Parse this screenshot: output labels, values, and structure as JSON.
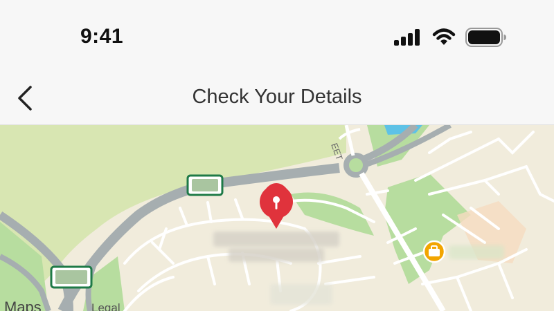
{
  "status_bar": {
    "time": "9:41",
    "signal_icon": "cellular-signal-icon",
    "wifi_icon": "wifi-icon",
    "battery_icon": "battery-icon"
  },
  "nav": {
    "back_icon": "chevron-left-icon",
    "title": "Check Your Details"
  },
  "map": {
    "street_label": "EET",
    "pin_icon": "location-pin-icon",
    "poi_icon": "briefcase-icon",
    "attribution": "Maps",
    "legal": "Legal",
    "colors": {
      "land": "#f1ecdc",
      "park": "#d8e6b2",
      "green": "#b7dd9f",
      "road": "#a6aeb0",
      "water": "#5ec2e6",
      "pin": "#e0333c",
      "poi": "#f2a500",
      "sign": "#1e7a47"
    }
  }
}
